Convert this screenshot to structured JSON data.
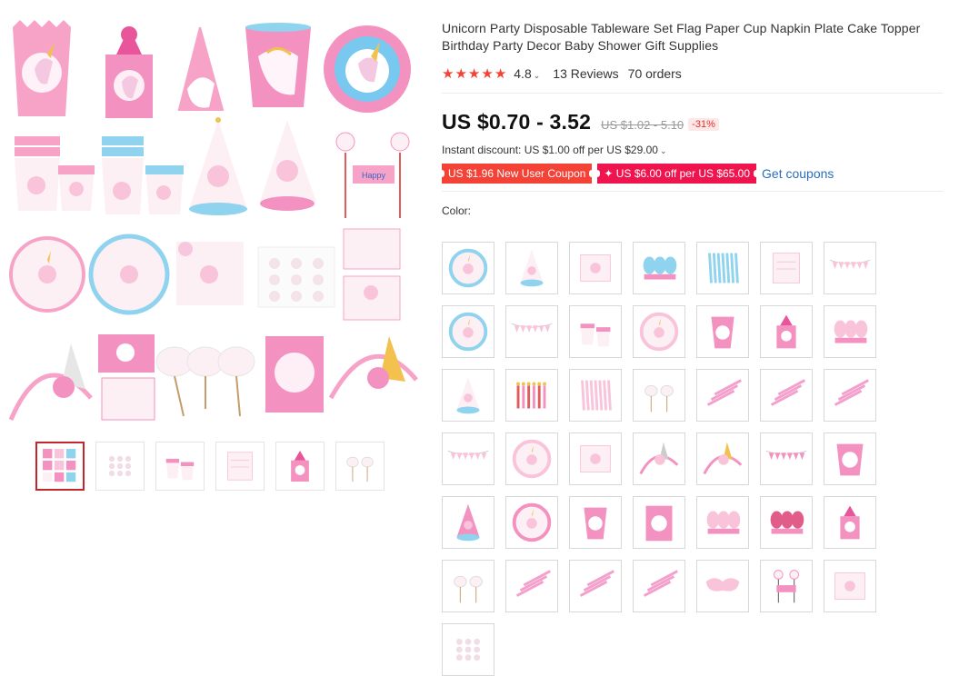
{
  "product": {
    "title": "Unicorn Party Disposable Tableware Set Flag Paper Cup Napkin Plate Cake Topper Birthday Party Decor Baby Shower Gift Supplies",
    "rating": "4.8",
    "stars": 5,
    "reviews": "13 Reviews",
    "orders": "70 orders",
    "price": "US $0.70 - 3.52",
    "old_price": "US $1.02 - 5.10",
    "discount": "-31%",
    "instant_discount": "Instant discount: US $1.00 off per US $29.00",
    "coupons": [
      "US $1.96 New User Coupon",
      "✦ US $6.00 off per US $65.00"
    ],
    "get_coupons": "Get coupons",
    "color_label": "Color:"
  },
  "colors": {
    "accent_red": "#f44336",
    "coupon_pink": "#f0144e",
    "link_blue": "#2a6ebb",
    "thumb_active": "#c1272d"
  },
  "caret_glyph": "⌄",
  "thumbnails": [
    {
      "icon": "collage-thumb"
    },
    {
      "icon": "stickers-thumb"
    },
    {
      "icon": "cups-thumb"
    },
    {
      "icon": "layout-thumb"
    },
    {
      "icon": "set-thumb"
    },
    {
      "icon": "toppers-thumb"
    }
  ],
  "swatches": [
    "plate-blue-ring",
    "cone-hat",
    "napkin",
    "blowouts-blue",
    "straws-blue",
    "invitation-card",
    "banner-small",
    "plate-blue-ring",
    "banner-flags",
    "cups-pink",
    "plate-pink",
    "popcorn-box",
    "gift-box-pink",
    "blowouts-pink",
    "cone-hat-pink",
    "candles",
    "straws-pink",
    "cake-toppers",
    "forks-pink",
    "spoons-pink",
    "knives-pink",
    "banner-small",
    "plate-floral",
    "napkin-floral",
    "headband",
    "headband-gold",
    "banner-pink",
    "cup-pink-unicorn",
    "cone-hat-unicorn",
    "plate-unicorn",
    "popcorn-unicorn",
    "bag-unicorn",
    "blowouts-multi",
    "blowouts-red",
    "gift-box-unicorn",
    "cupcake-picks",
    "spoons-pink",
    "forks-pink",
    "knives-pink",
    "eye-masks",
    "cake-topper",
    "napkins-unicorn",
    "stickers"
  ]
}
